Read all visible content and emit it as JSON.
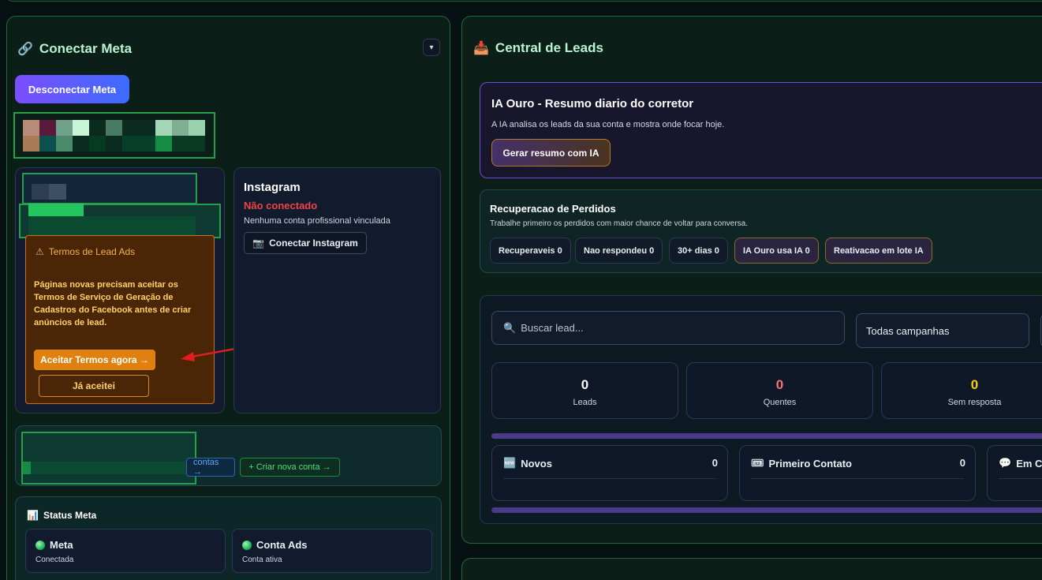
{
  "left_panel": {
    "title": "Conectar Meta",
    "title_icon": "🔗",
    "collapse_glyph": "▾",
    "disconnect_label": "Desconectar Meta",
    "warning": {
      "title": "Termos de Lead Ads",
      "icon": "⚠",
      "text": "Páginas novas precisam aceitar os Termos de Serviço de Geração de Cadastros do Facebook antes de criar anúncios de lead.",
      "accept_label": "Aceitar Termos agora →",
      "accepted_label": "Já aceitei"
    },
    "instagram": {
      "title": "Instagram",
      "status": "Não conectado",
      "sub": "Nenhuma conta profissional vinculada",
      "button_icon": "📷",
      "button_label": "Conectar Instagram"
    },
    "accounts": {
      "contas_label": "contas →",
      "create_label": "+ Criar nova conta →"
    },
    "status_meta": {
      "title": "Status Meta",
      "icon": "📊",
      "items": [
        {
          "name": "Meta",
          "sub": "Conectada"
        },
        {
          "name": "Conta Ads",
          "sub": "Conta ativa"
        }
      ]
    }
  },
  "right_panel": {
    "title": "Central de Leads",
    "title_icon": "📥",
    "ia": {
      "title": "IA Ouro - Resumo diario do corretor",
      "sub": "A IA analisa os leads da sua conta e mostra onde focar hoje.",
      "button": "Gerar resumo com IA"
    },
    "recovery": {
      "title": "Recuperacao de Perdidos",
      "sub": "Trabalhe primeiro os perdidos com maior chance de voltar para conversa.",
      "pills": [
        "Recuperaveis 0",
        "Nao respondeu 0",
        "30+ dias 0",
        "IA Ouro usa IA 0",
        "Reativacao em lote IA"
      ]
    },
    "search": {
      "icon": "🔍",
      "placeholder": "Buscar lead..."
    },
    "campaign_select": "Todas campanhas",
    "stats": [
      {
        "value": "0",
        "label": "Leads",
        "color": "#ffffff"
      },
      {
        "value": "0",
        "label": "Quentes",
        "color": "#f87171"
      },
      {
        "value": "0",
        "label": "Sem resposta",
        "color": "#facc15"
      }
    ],
    "columns": [
      {
        "icon": "🆕",
        "name": "Novos",
        "count": "0"
      },
      {
        "icon": "🎟",
        "name": "Primeiro Contato",
        "count": "0"
      },
      {
        "icon": "💬",
        "name": "Em C",
        "count": ""
      }
    ]
  },
  "colors": {
    "accent_green": "#25a04a",
    "panel_border": "#1e6b3a",
    "warning_bg": "#4a2606",
    "warning_button": "#e0810f",
    "danger": "#ef4444",
    "purple": "#6a4fd6"
  }
}
